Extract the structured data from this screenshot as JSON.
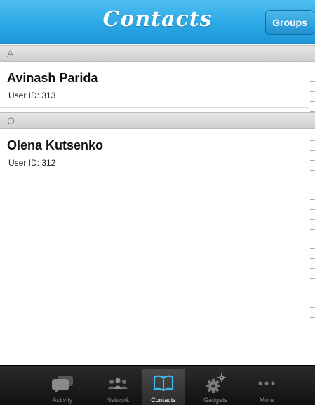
{
  "header": {
    "title": "Contacts",
    "groups_button": "Groups"
  },
  "sections": [
    {
      "letter": "A",
      "contacts": [
        {
          "name": "Avinash Parida",
          "user_id": "User ID: 313"
        }
      ]
    },
    {
      "letter": "O",
      "contacts": [
        {
          "name": "Olena Kutsenko",
          "user_id": "User ID: 312"
        }
      ]
    }
  ],
  "tabs": [
    {
      "label": "Activity",
      "icon": "chat-bubble-icon",
      "active": false
    },
    {
      "label": "Network",
      "icon": "people-icon",
      "active": false
    },
    {
      "label": "Contacts",
      "icon": "book-icon",
      "active": true
    },
    {
      "label": "Gadgets",
      "icon": "gears-icon",
      "active": false
    },
    {
      "label": "More",
      "icon": "more-dots-icon",
      "active": false
    }
  ],
  "colors": {
    "navbar": "#2ba8e6",
    "tabbar": "#1a1a1a",
    "active_tab_icon": "#3fb6ef"
  }
}
